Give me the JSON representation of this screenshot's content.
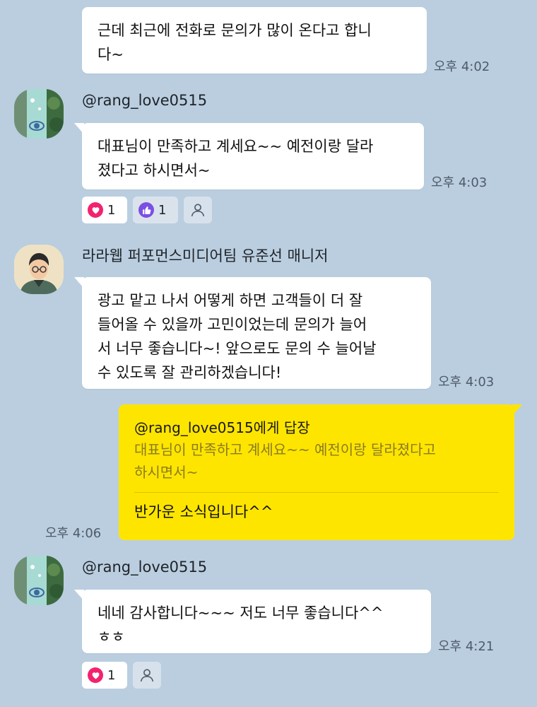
{
  "messages": {
    "m1": {
      "text": "근데 최근에 전화로 문의가 많이 온다고 합니\n다~",
      "time": "오후 4:02"
    },
    "m2": {
      "sender": "@rang_love0515",
      "text": "대표님이 만족하고 계세요~~ 예전이랑 달라\n졌다고 하시면서~",
      "time": "오후 4:03",
      "reactions": [
        {
          "icon": "heart-icon",
          "count": "1"
        },
        {
          "icon": "thumbs-up-icon",
          "count": "1"
        }
      ]
    },
    "m3": {
      "sender": "라라웹 퍼포먼스미디어팀 유준선 매니저",
      "text": "광고 맡고 나서 어떻게 하면 고객들이 더 잘\n들어올 수 있을까 고민이었는데 문의가 늘어\n서 너무 좋습니다~! 앞으로도 문의 수 늘어날\n수 있도록 잘 관리하겠습니다!",
      "time": "오후 4:03"
    },
    "m4": {
      "reply_to": "@rang_love0515에게 답장",
      "quote": "대표님이 만족하고 계세요~~ 예전이랑 달라졌다고\n하시면서~",
      "text": "반가운 소식입니다^^",
      "time": "오후 4:06"
    },
    "m5": {
      "sender": "@rang_love0515",
      "text": "네네 감사합니다~~~ 저도 너무 좋습니다^^\nㅎㅎ",
      "time": "오후 4:21",
      "reactions": [
        {
          "icon": "heart-icon",
          "count": "1"
        }
      ]
    }
  },
  "colors": {
    "background": "#bacee0",
    "bubble_other": "#ffffff",
    "bubble_mine": "#fee500",
    "heart": "#f2236e",
    "thumbs": "#7b4fe4"
  }
}
